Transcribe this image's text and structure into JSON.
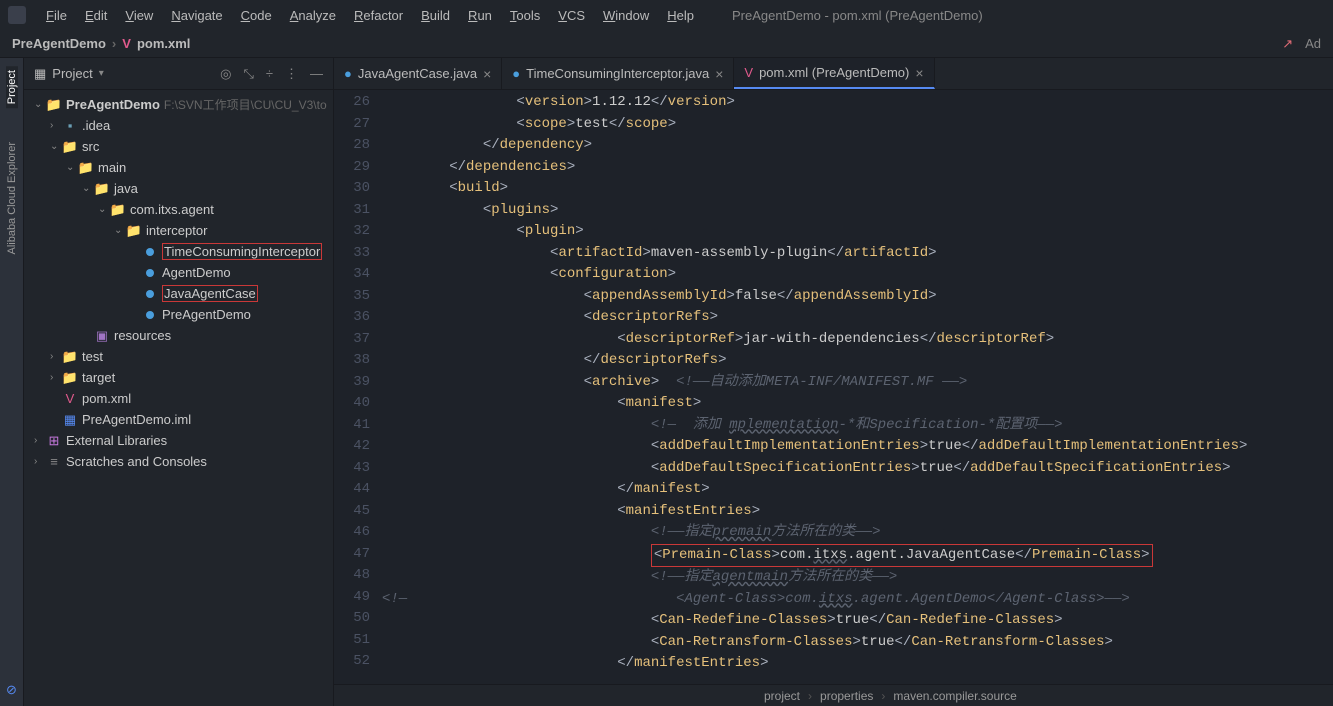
{
  "titlebar": {
    "menus": [
      "File",
      "Edit",
      "View",
      "Navigate",
      "Code",
      "Analyze",
      "Refactor",
      "Build",
      "Run",
      "Tools",
      "VCS",
      "Window",
      "Help"
    ],
    "title": "PreAgentDemo - pom.xml (PreAgentDemo)"
  },
  "navbar": {
    "path": [
      "PreAgentDemo",
      "pom.xml"
    ],
    "right_hint": "Ad"
  },
  "sidebar": {
    "tool": "Project",
    "nodes": [
      {
        "indent": 10,
        "chev": "v",
        "icon": "folder",
        "label": "PreAgentDemo",
        "bold": true,
        "suffix": "F:\\SVN工作项目\\CU\\CU_V3\\to"
      },
      {
        "indent": 26,
        "chev": ">",
        "icon": "folder-dot",
        "label": ".idea"
      },
      {
        "indent": 26,
        "chev": "v",
        "icon": "folder-blue",
        "label": "src"
      },
      {
        "indent": 42,
        "chev": "v",
        "icon": "folder",
        "label": "main"
      },
      {
        "indent": 58,
        "chev": "v",
        "icon": "folder-blue",
        "label": "java"
      },
      {
        "indent": 74,
        "chev": "v",
        "icon": "folder",
        "label": "com.itxs.agent"
      },
      {
        "indent": 90,
        "chev": "v",
        "icon": "folder",
        "label": "interceptor"
      },
      {
        "indent": 106,
        "chev": "",
        "icon": "class",
        "label": "TimeConsumingInterceptor",
        "red": true
      },
      {
        "indent": 106,
        "chev": "",
        "icon": "class",
        "label": "AgentDemo"
      },
      {
        "indent": 106,
        "chev": "",
        "icon": "class",
        "label": "JavaAgentCase",
        "red": true
      },
      {
        "indent": 106,
        "chev": "",
        "icon": "class",
        "label": "PreAgentDemo"
      },
      {
        "indent": 58,
        "chev": "",
        "icon": "resources",
        "label": "resources"
      },
      {
        "indent": 26,
        "chev": ">",
        "icon": "folder-green",
        "label": "test"
      },
      {
        "indent": 26,
        "chev": ">",
        "icon": "folder-red",
        "label": "target"
      },
      {
        "indent": 26,
        "chev": "",
        "icon": "pom",
        "label": "pom.xml"
      },
      {
        "indent": 26,
        "chev": "",
        "icon": "iml",
        "label": "PreAgentDemo.iml"
      },
      {
        "indent": 10,
        "chev": ">",
        "icon": "lib",
        "label": "External Libraries"
      },
      {
        "indent": 10,
        "chev": ">",
        "icon": "scratch",
        "label": "Scratches and Consoles"
      }
    ]
  },
  "tabs": [
    {
      "icon": "class",
      "label": "JavaAgentCase.java",
      "active": false
    },
    {
      "icon": "class",
      "label": "TimeConsumingInterceptor.java",
      "active": false
    },
    {
      "icon": "pom",
      "label": "pom.xml (PreAgentDemo)",
      "active": true
    }
  ],
  "editor": {
    "first_line": 26,
    "lines": [
      {
        "indent": 16,
        "tokens": [
          {
            "t": "<",
            "c": "p"
          },
          {
            "t": "version",
            "c": "tag"
          },
          {
            "t": ">",
            "c": "p"
          },
          {
            "t": "1.12.12",
            "c": "txt"
          },
          {
            "t": "</",
            "c": "p"
          },
          {
            "t": "version",
            "c": "tag"
          },
          {
            "t": ">",
            "c": "p"
          }
        ]
      },
      {
        "indent": 16,
        "tokens": [
          {
            "t": "<",
            "c": "p"
          },
          {
            "t": "scope",
            "c": "tag"
          },
          {
            "t": ">",
            "c": "p"
          },
          {
            "t": "test",
            "c": "txt"
          },
          {
            "t": "</",
            "c": "p"
          },
          {
            "t": "scope",
            "c": "tag"
          },
          {
            "t": ">",
            "c": "p"
          }
        ]
      },
      {
        "indent": 12,
        "tokens": [
          {
            "t": "</",
            "c": "p"
          },
          {
            "t": "dependency",
            "c": "tag"
          },
          {
            "t": ">",
            "c": "p"
          }
        ]
      },
      {
        "indent": 8,
        "tokens": [
          {
            "t": "</",
            "c": "p"
          },
          {
            "t": "dependencies",
            "c": "tag"
          },
          {
            "t": ">",
            "c": "p"
          }
        ]
      },
      {
        "indent": 8,
        "tokens": [
          {
            "t": "<",
            "c": "p"
          },
          {
            "t": "build",
            "c": "tag"
          },
          {
            "t": ">",
            "c": "p"
          }
        ]
      },
      {
        "indent": 12,
        "tokens": [
          {
            "t": "<",
            "c": "p"
          },
          {
            "t": "plugins",
            "c": "tag"
          },
          {
            "t": ">",
            "c": "p"
          }
        ]
      },
      {
        "indent": 16,
        "tokens": [
          {
            "t": "<",
            "c": "p"
          },
          {
            "t": "plugin",
            "c": "tag"
          },
          {
            "t": ">",
            "c": "p"
          }
        ]
      },
      {
        "indent": 20,
        "tokens": [
          {
            "t": "<",
            "c": "p"
          },
          {
            "t": "artifactId",
            "c": "tag"
          },
          {
            "t": ">",
            "c": "p"
          },
          {
            "t": "maven-assembly-plugin",
            "c": "txt"
          },
          {
            "t": "</",
            "c": "p"
          },
          {
            "t": "artifactId",
            "c": "tag"
          },
          {
            "t": ">",
            "c": "p"
          }
        ]
      },
      {
        "indent": 20,
        "tokens": [
          {
            "t": "<",
            "c": "p"
          },
          {
            "t": "configuration",
            "c": "tag"
          },
          {
            "t": ">",
            "c": "p"
          }
        ]
      },
      {
        "indent": 24,
        "tokens": [
          {
            "t": "<",
            "c": "p"
          },
          {
            "t": "appendAssemblyId",
            "c": "tag"
          },
          {
            "t": ">",
            "c": "p"
          },
          {
            "t": "false",
            "c": "txt"
          },
          {
            "t": "</",
            "c": "p"
          },
          {
            "t": "appendAssemblyId",
            "c": "tag"
          },
          {
            "t": ">",
            "c": "p"
          }
        ]
      },
      {
        "indent": 24,
        "tokens": [
          {
            "t": "<",
            "c": "p"
          },
          {
            "t": "descriptorRefs",
            "c": "tag"
          },
          {
            "t": ">",
            "c": "p"
          }
        ]
      },
      {
        "indent": 28,
        "tokens": [
          {
            "t": "<",
            "c": "p"
          },
          {
            "t": "descriptorRef",
            "c": "tag"
          },
          {
            "t": ">",
            "c": "p"
          },
          {
            "t": "jar-with-dependencies",
            "c": "txt"
          },
          {
            "t": "</",
            "c": "p"
          },
          {
            "t": "descriptorRef",
            "c": "tag"
          },
          {
            "t": ">",
            "c": "p"
          }
        ]
      },
      {
        "indent": 24,
        "tokens": [
          {
            "t": "</",
            "c": "p"
          },
          {
            "t": "descriptorRefs",
            "c": "tag"
          },
          {
            "t": ">",
            "c": "p"
          }
        ]
      },
      {
        "indent": 24,
        "tokens": [
          {
            "t": "<",
            "c": "p"
          },
          {
            "t": "archive",
            "c": "tag"
          },
          {
            "t": ">",
            "c": "p"
          },
          {
            "t": "  <!——自动添加META-INF/MANIFEST.MF ——>",
            "c": "comment"
          }
        ]
      },
      {
        "indent": 28,
        "tokens": [
          {
            "t": "<",
            "c": "p"
          },
          {
            "t": "manifest",
            "c": "tag"
          },
          {
            "t": ">",
            "c": "p"
          }
        ]
      },
      {
        "indent": 32,
        "tokens": [
          {
            "t": "<!—  添加 ",
            "c": "comment"
          },
          {
            "t": "mplementation",
            "c": "comment",
            "wavy": true
          },
          {
            "t": "-*和Specification-*配置项——>",
            "c": "comment"
          }
        ]
      },
      {
        "indent": 32,
        "tokens": [
          {
            "t": "<",
            "c": "p"
          },
          {
            "t": "addDefaultImplementationEntries",
            "c": "tag"
          },
          {
            "t": ">",
            "c": "p"
          },
          {
            "t": "true",
            "c": "txt"
          },
          {
            "t": "</",
            "c": "p"
          },
          {
            "t": "addDefaultImplementationEntries",
            "c": "tag"
          },
          {
            "t": ">",
            "c": "p"
          }
        ]
      },
      {
        "indent": 32,
        "tokens": [
          {
            "t": "<",
            "c": "p"
          },
          {
            "t": "addDefaultSpecificationEntries",
            "c": "tag"
          },
          {
            "t": ">",
            "c": "p"
          },
          {
            "t": "true",
            "c": "txt"
          },
          {
            "t": "</",
            "c": "p"
          },
          {
            "t": "addDefaultSpecificationEntries",
            "c": "tag"
          },
          {
            "t": ">",
            "c": "p"
          }
        ]
      },
      {
        "indent": 28,
        "tokens": [
          {
            "t": "</",
            "c": "p"
          },
          {
            "t": "manifest",
            "c": "tag"
          },
          {
            "t": ">",
            "c": "p"
          }
        ]
      },
      {
        "indent": 28,
        "tokens": [
          {
            "t": "<",
            "c": "p"
          },
          {
            "t": "manifestEntries",
            "c": "tag"
          },
          {
            "t": ">",
            "c": "p"
          }
        ]
      },
      {
        "indent": 32,
        "tokens": [
          {
            "t": "<!——指定",
            "c": "comment"
          },
          {
            "t": "premain",
            "c": "comment",
            "wavy": true
          },
          {
            "t": "方法所在的类——>",
            "c": "comment"
          }
        ]
      },
      {
        "indent": 32,
        "hl": true,
        "tokens": [
          {
            "t": "<",
            "c": "p"
          },
          {
            "t": "Premain-Class",
            "c": "tag"
          },
          {
            "t": ">",
            "c": "p"
          },
          {
            "t": "com.",
            "c": "txt"
          },
          {
            "t": "itxs",
            "c": "txt",
            "wavy": true
          },
          {
            "t": ".agent.JavaAgentCase",
            "c": "txt"
          },
          {
            "t": "</",
            "c": "p"
          },
          {
            "t": "Premain-Class",
            "c": "tag"
          },
          {
            "t": ">",
            "c": "p"
          }
        ]
      },
      {
        "indent": 32,
        "tokens": [
          {
            "t": "<!——指定",
            "c": "comment"
          },
          {
            "t": "agentmain",
            "c": "comment",
            "wavy": true
          },
          {
            "t": "方法所在的类——>",
            "c": "comment"
          }
        ]
      },
      {
        "indent": 0,
        "tokens": [
          {
            "t": "<!—",
            "c": "comment"
          },
          {
            "t": "                                <Agent-Class>com.",
            "c": "comment"
          },
          {
            "t": "itxs",
            "c": "comment",
            "wavy": true
          },
          {
            "t": ".agent.AgentDemo</Agent-Class>——>",
            "c": "comment"
          }
        ]
      },
      {
        "indent": 32,
        "tokens": [
          {
            "t": "<",
            "c": "p"
          },
          {
            "t": "Can-Redefine-Classes",
            "c": "tag"
          },
          {
            "t": ">",
            "c": "p"
          },
          {
            "t": "true",
            "c": "txt"
          },
          {
            "t": "</",
            "c": "p"
          },
          {
            "t": "Can-Redefine-Classes",
            "c": "tag"
          },
          {
            "t": ">",
            "c": "p"
          }
        ]
      },
      {
        "indent": 32,
        "tokens": [
          {
            "t": "<",
            "c": "p"
          },
          {
            "t": "Can-Retransform-Classes",
            "c": "tag"
          },
          {
            "t": ">",
            "c": "p"
          },
          {
            "t": "true",
            "c": "txt"
          },
          {
            "t": "</",
            "c": "p"
          },
          {
            "t": "Can-Retransform-Classes",
            "c": "tag"
          },
          {
            "t": ">",
            "c": "p"
          }
        ]
      },
      {
        "indent": 28,
        "tokens": [
          {
            "t": "</",
            "c": "p"
          },
          {
            "t": "manifestEntries",
            "c": "tag"
          },
          {
            "t": ">",
            "c": "p"
          }
        ]
      }
    ]
  },
  "status": {
    "path": [
      "project",
      "properties",
      "maven.compiler.source"
    ]
  },
  "rail": {
    "items": [
      "Project",
      "Alibaba Cloud Explorer"
    ]
  }
}
